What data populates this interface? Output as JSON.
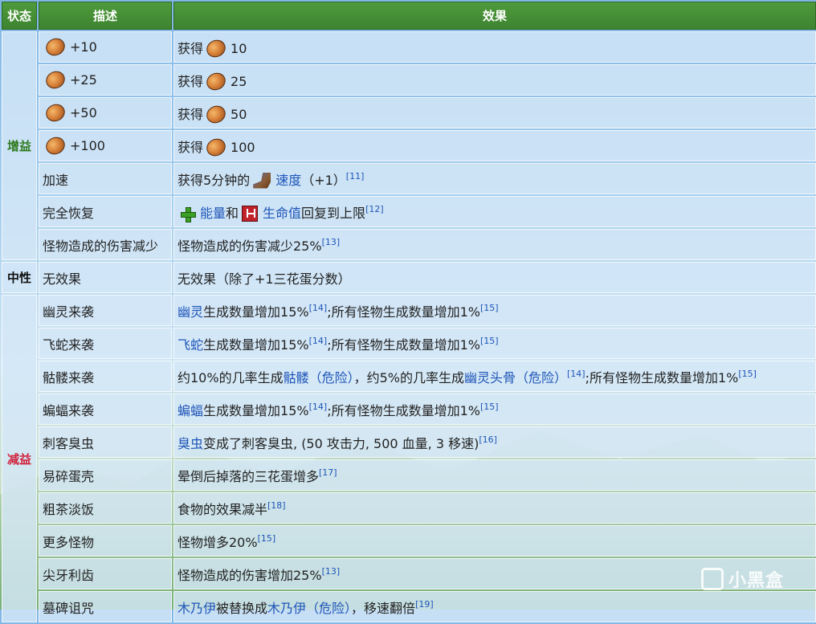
{
  "headers": {
    "state": "状态",
    "description": "描述",
    "effect": "效果"
  },
  "states": {
    "buff": "增益",
    "neutral": "中性",
    "debuff": "减益"
  },
  "rows": [
    {
      "desc": "+10",
      "effect_pre": "获得",
      "effect_val": "10"
    },
    {
      "desc": "+25",
      "effect_pre": "获得",
      "effect_val": "25"
    },
    {
      "desc": "+50",
      "effect_pre": "获得",
      "effect_val": "50"
    },
    {
      "desc": "+100",
      "effect_pre": "获得",
      "effect_val": "100"
    },
    {
      "desc": "加速",
      "effect_pre": "获得5分钟的",
      "effect_link": "速度",
      "effect_post": "（+1）",
      "ref": "[11]"
    },
    {
      "desc": "完全恢复",
      "effect_link1": "能量",
      "effect_mid": "和",
      "effect_link2": "生命值",
      "effect_post": "回复到上限",
      "ref": "[12]"
    },
    {
      "desc": "怪物造成的伤害减少",
      "effect_text": "怪物造成的伤害减少25%",
      "ref": "[13]"
    },
    {
      "desc": "无效果",
      "effect_text": "无效果（除了+1三花蛋分数）"
    },
    {
      "desc": "幽灵来袭",
      "effect_link": "幽灵",
      "effect_post": "生成数量增加15%",
      "ref": "[14]",
      "effect_tail": ";所有怪物生成数量增加1%",
      "ref2": "[15]"
    },
    {
      "desc": "飞蛇来袭",
      "effect_link": "飞蛇",
      "effect_post": "生成数量增加15%",
      "ref": "[14]",
      "effect_tail": ";所有怪物生成数量增加1%",
      "ref2": "[15]"
    },
    {
      "desc": "骷髅来袭",
      "effect_pre": "约10%的几率生成",
      "effect_link": "骷髅（危险）",
      "effect_mid": "，约5%的几率生成",
      "effect_link2": "幽灵头骨（危险）",
      "ref": "[14]",
      "effect_tail": ";所有怪物生成数量增加1%",
      "ref2": "[15]"
    },
    {
      "desc": "蝙蝠来袭",
      "effect_link": "蝙蝠",
      "effect_post": "生成数量增加15%",
      "ref": "[14]",
      "effect_tail": ";所有怪物生成数量增加1%",
      "ref2": "[15]"
    },
    {
      "desc": "刺客臭虫",
      "effect_link": "臭虫",
      "effect_post": "变成了刺客臭虫, (50 攻击力, 500 血量, 3 移速)",
      "ref": "[16]"
    },
    {
      "desc": "易碎蛋壳",
      "effect_text": "晕倒后掉落的三花蛋增多",
      "ref": "[17]"
    },
    {
      "desc": "粗茶淡饭",
      "effect_text": "食物的效果减半",
      "ref": "[18]"
    },
    {
      "desc": "更多怪物",
      "effect_text": "怪物增多20%",
      "ref": "[15]"
    },
    {
      "desc": "尖牙利齿",
      "effect_text": "怪物造成的伤害增加25%",
      "ref": "[13]"
    },
    {
      "desc": "墓碑诅咒",
      "effect_link": "木乃伊",
      "effect_post": "被替换成",
      "effect_link2": "木乃伊（危险）",
      "effect_tail": "，移速翻倍",
      "ref": "[19]"
    }
  ],
  "watermark": "小黑盒",
  "colors": {
    "header_bg": "#3d8430",
    "buff": "#2e7a1e",
    "debuff": "#d0213c",
    "link": "#1f55b8"
  }
}
